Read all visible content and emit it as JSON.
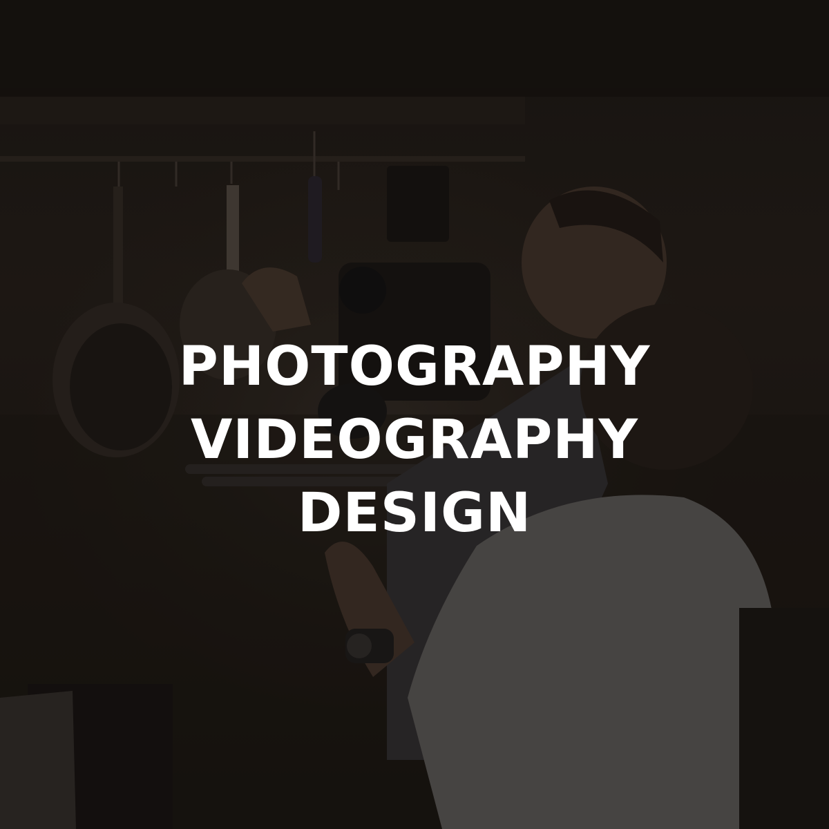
{
  "hero": {
    "lines": [
      "PHOTOGRAPHY",
      "VIDEOGRAPHY",
      "DESIGN"
    ]
  },
  "colors": {
    "text": "#ffffff",
    "background": "#1a1612"
  }
}
